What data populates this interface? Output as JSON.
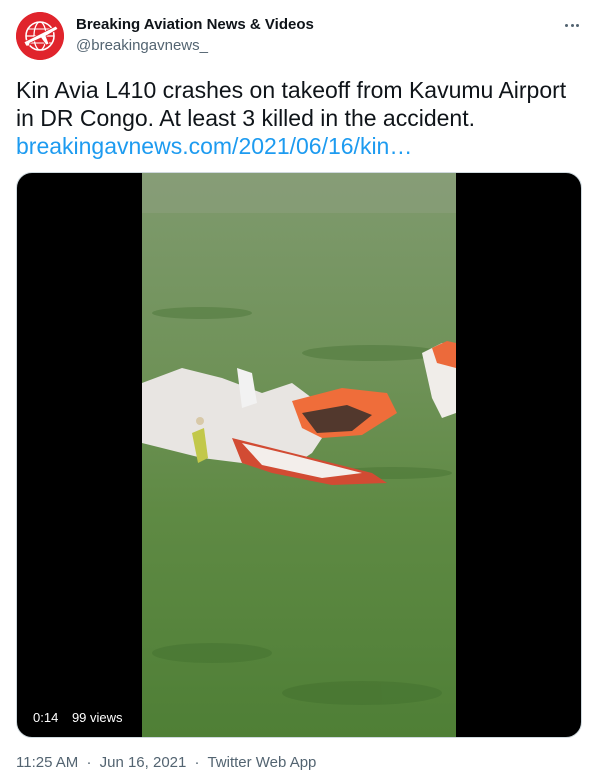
{
  "author": {
    "name": "Breaking Aviation News & Videos",
    "handle": "@breakingavnews_",
    "avatar_icon": "globe-plane-logo",
    "avatar_color": "#e0242c"
  },
  "tweet": {
    "text": "Kin Avia L410 crashes on takeoff from Kavumu Airport in DR Congo. At least 3 killed in the accident.",
    "link_text": "breakingavnews.com/2021/06/16/kin…"
  },
  "video": {
    "duration": "0:14",
    "views": "99 views"
  },
  "meta": {
    "time": "11:25 AM",
    "separator": "·",
    "date": "Jun 16, 2021",
    "client": "Twitter Web App"
  },
  "colors": {
    "link": "#1d9bf0",
    "secondary_text": "#536471",
    "primary_text": "#0f1419"
  }
}
